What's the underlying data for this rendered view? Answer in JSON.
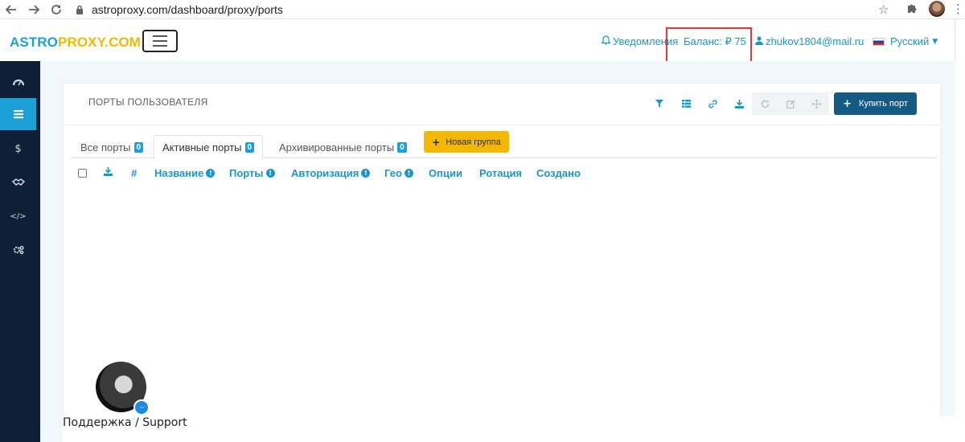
{
  "browser": {
    "url": "astroproxy.com/dashboard/proxy/ports",
    "icons": [
      "back-arrow-icon",
      "forward-arrow-icon",
      "reload-icon",
      "lock-icon",
      "star-icon",
      "extensions-icon",
      "profile-avatar",
      "more-vert-icon"
    ]
  },
  "header": {
    "logo_part1": "ASTRO",
    "logo_part2": "PROXY.COM",
    "notifications_label": "Уведомления",
    "balance_label": "Баланс: ₽ 75",
    "user_email": "zhukov1804@mail.ru",
    "language_label": "Русский",
    "colors": {
      "brand_blue": "#1ba1d8",
      "brand_yellow": "#f5b800",
      "highlight_red": "#e53935"
    }
  },
  "sidebar": {
    "items": [
      {
        "icon": "dashboard-icon",
        "active": false
      },
      {
        "icon": "list-icon",
        "active": true
      },
      {
        "icon": "dollar-icon",
        "active": false
      },
      {
        "icon": "handshake-icon",
        "active": false
      },
      {
        "icon": "code-icon",
        "active": false
      },
      {
        "icon": "settings-icon",
        "active": false
      }
    ],
    "colors": {
      "background": "#0f1f36",
      "active": "#1ba1d8"
    }
  },
  "card": {
    "title": "ПОРТЫ ПОЛЬЗОВАТЕЛЯ",
    "toolbar": {
      "tools": [
        "filter-icon",
        "table-icon",
        "link-icon",
        "download-icon",
        "refresh-icon",
        "edit-icon",
        "move-icon"
      ],
      "buy_label": "Купить порт"
    },
    "tabs": [
      {
        "label": "Все порты",
        "count": "0",
        "active": false
      },
      {
        "label": "Активные порты",
        "count": "0",
        "active": true
      },
      {
        "label": "Архивированные порты",
        "count": "0",
        "active": false
      }
    ],
    "new_group_label": "Новая группа",
    "columns": {
      "hash": "#",
      "name": "Название",
      "ports": "Порты",
      "authorization": "Авторизация",
      "geo": "Гео",
      "options": "Опции",
      "rotation": "Ротация",
      "created": "Создано"
    }
  },
  "support": {
    "label": "Поддержка / Support"
  }
}
